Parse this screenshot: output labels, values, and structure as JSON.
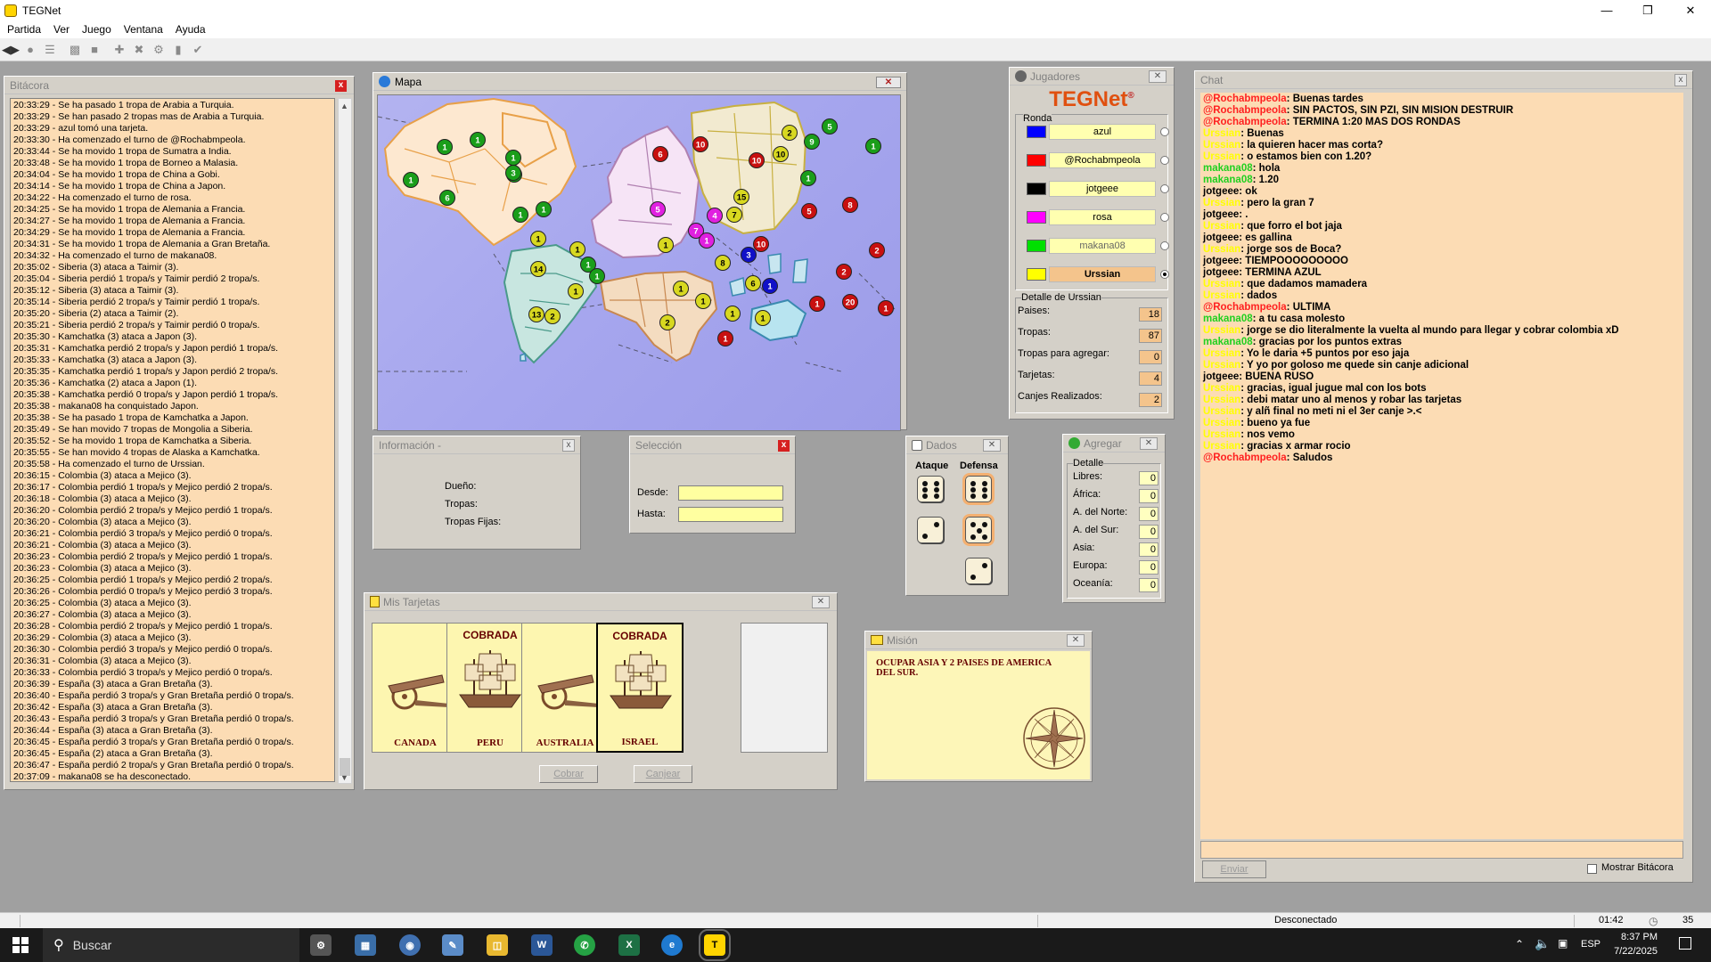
{
  "window": {
    "title": "TEGNet"
  },
  "menu": [
    "Partida",
    "Ver",
    "Juego",
    "Ventana",
    "Ayuda"
  ],
  "bitacora": {
    "title": "Bitácora",
    "lines": [
      "20:33:29 - Se ha pasado 1 tropa de Arabia a Turquia.",
      "20:33:29 - Se han pasado 2 tropas mas de Arabia a Turquia.",
      "20:33:29 - azul tomó una tarjeta.",
      "20:33:30 - Ha comenzado el turno de @Rochabmpeola.",
      "20:33:44 - Se ha movido 1 tropa de Sumatra a India.",
      "20:33:48 - Se ha movido 1 tropa de Borneo a Malasia.",
      "20:34:04 - Se ha movido 1 tropa de China a Gobi.",
      "20:34:14 - Se ha movido 1 tropa de China a Japon.",
      "20:34:22 - Ha comenzado el turno de rosa.",
      "20:34:25 - Se ha movido 1 tropa de Alemania a Francia.",
      "20:34:27 - Se ha movido 1 tropa de Alemania a Francia.",
      "20:34:29 - Se ha movido 1 tropa de Alemania a Francia.",
      "20:34:31 - Se ha movido 1 tropa de Alemania a Gran Bretaña.",
      "20:34:32 - Ha comenzado el turno de makana08.",
      "20:35:02 - Siberia (3) ataca a Taimir (3).",
      "20:35:04 - Siberia perdió 1 tropa/s y Taimir perdió 2 tropa/s.",
      "20:35:12 - Siberia (3) ataca a Taimir (3).",
      "20:35:14 - Siberia perdió 2 tropa/s y Taimir perdió 1 tropa/s.",
      "20:35:20 - Siberia (2) ataca a Taimir (2).",
      "20:35:21 - Siberia perdió 2 tropa/s y Taimir perdió 0 tropa/s.",
      "20:35:30 - Kamchatka (3) ataca a Japon (3).",
      "20:35:31 - Kamchatka perdió 2 tropa/s y Japon perdió 1 tropa/s.",
      "20:35:33 - Kamchatka (3) ataca a Japon (3).",
      "20:35:35 - Kamchatka perdió 1 tropa/s y Japon perdió 2 tropa/s.",
      "20:35:36 - Kamchatka (2) ataca a Japon (1).",
      "20:35:38 - Kamchatka perdió 0 tropa/s y Japon perdió 1 tropa/s.",
      "20:35:38 - makana08 ha conquistado Japon.",
      "20:35:38 - Se ha pasado 1 tropa de Kamchatka a Japon.",
      "20:35:49 - Se han movido 7 tropas de Mongolia a Siberia.",
      "20:35:52 - Se ha movido 1 tropa de Kamchatka a Siberia.",
      "20:35:55 - Se han movido 4 tropas de Alaska a Kamchatka.",
      "20:35:58 - Ha comenzado el turno de Urssian.",
      "20:36:15 - Colombia (3) ataca a Mejico (3).",
      "20:36:17 - Colombia perdió 1 tropa/s y Mejico perdió 2 tropa/s.",
      "20:36:18 - Colombia (3) ataca a Mejico (3).",
      "20:36:20 - Colombia perdió 2 tropa/s y Mejico perdió 1 tropa/s.",
      "20:36:20 - Colombia (3) ataca a Mejico (3).",
      "20:36:21 - Colombia perdió 3 tropa/s y Mejico perdió 0 tropa/s.",
      "20:36:21 - Colombia (3) ataca a Mejico (3).",
      "20:36:23 - Colombia perdió 2 tropa/s y Mejico perdió 1 tropa/s.",
      "20:36:23 - Colombia (3) ataca a Mejico (3).",
      "20:36:25 - Colombia perdió 1 tropa/s y Mejico perdió 2 tropa/s.",
      "20:36:26 - Colombia perdió 0 tropa/s y Mejico perdió 3 tropa/s.",
      "20:36:25 - Colombia (3) ataca a Mejico (3).",
      "20:36:27 - Colombia (3) ataca a Mejico (3).",
      "20:36:28 - Colombia perdió 2 tropa/s y Mejico perdió 1 tropa/s.",
      "20:36:29 - Colombia (3) ataca a Mejico (3).",
      "20:36:30 - Colombia perdió 3 tropa/s y Mejico perdió 0 tropa/s.",
      "20:36:31 - Colombia (3) ataca a Mejico (3).",
      "20:36:33 - Colombia perdió 3 tropa/s y Mejico perdió 0 tropa/s.",
      "20:36:39 - España (3) ataca a Gran Bretaña (3).",
      "20:36:40 - España perdió 3 tropa/s y Gran Bretaña perdió 0 tropa/s.",
      "20:36:42 - España (3) ataca a Gran Bretaña (3).",
      "20:36:43 - España perdió 3 tropa/s y Gran Bretaña perdió 0 tropa/s.",
      "20:36:44 - España (3) ataca a Gran Bretaña (3).",
      "20:36:45 - España perdió 3 tropa/s y Gran Bretaña perdió 0 tropa/s.",
      "20:36:45 - España (2) ataca a Gran Bretaña (3).",
      "20:36:47 - España perdió 2 tropa/s y Gran Bretaña perdió 0 tropa/s.",
      "20:37:09 - makana08 se ha desconectado."
    ]
  },
  "mapa": {
    "title": "Mapa",
    "markers": [
      {
        "n": "1",
        "c": "#1a9e1a"
      },
      {
        "n": "1",
        "c": "#1a9e1a"
      },
      {
        "n": "6",
        "c": "#1a9e1a"
      },
      {
        "n": "1",
        "c": "#1a9e1a"
      },
      {
        "n": "1",
        "c": "#1a9e1a"
      },
      {
        "n": "1",
        "c": "#1a9e1a"
      },
      {
        "n": "1",
        "c": "#1a9e1a"
      },
      {
        "n": "1",
        "c": "#1a9e1a"
      },
      {
        "n": "1",
        "c": "#1a9e1a"
      },
      {
        "n": "1",
        "c": "#1a9e1a"
      },
      {
        "n": "3",
        "c": "#1a9e1a"
      },
      {
        "n": "6",
        "c": "#c81010"
      },
      {
        "n": "10",
        "c": "#c81010"
      },
      {
        "n": "5",
        "c": "#e020e0"
      },
      {
        "n": "7",
        "c": "#e020e0"
      },
      {
        "n": "4",
        "c": "#e020e0"
      },
      {
        "n": "1",
        "c": "#e020e0"
      },
      {
        "n": "1",
        "c": "#d8d820"
      },
      {
        "n": "15",
        "c": "#d8d820"
      },
      {
        "n": "7",
        "c": "#d8d820"
      },
      {
        "n": "10",
        "c": "#c81010"
      },
      {
        "n": "3",
        "c": "#1010c8"
      },
      {
        "n": "6",
        "c": "#d8d820"
      },
      {
        "n": "1",
        "c": "#1010c8"
      },
      {
        "n": "10",
        "c": "#c81010"
      },
      {
        "n": "10",
        "c": "#d8d820"
      },
      {
        "n": "2",
        "c": "#d8d820"
      },
      {
        "n": "9",
        "c": "#1a9e1a"
      },
      {
        "n": "5",
        "c": "#1a9e1a"
      },
      {
        "n": "1",
        "c": "#1a9e1a"
      },
      {
        "n": "1",
        "c": "#1a9e1a"
      },
      {
        "n": "5",
        "c": "#c81010"
      },
      {
        "n": "8",
        "c": "#c81010"
      },
      {
        "n": "2",
        "c": "#c81010"
      },
      {
        "n": "2",
        "c": "#c81010"
      },
      {
        "n": "1",
        "c": "#d8d820"
      },
      {
        "n": "14",
        "c": "#d8d820"
      },
      {
        "n": "1",
        "c": "#d8d820"
      },
      {
        "n": "1",
        "c": "#d8d820"
      },
      {
        "n": "13",
        "c": "#d8d820"
      },
      {
        "n": "2",
        "c": "#d8d820"
      },
      {
        "n": "2",
        "c": "#d8d820"
      },
      {
        "n": "8",
        "c": "#d8d820"
      },
      {
        "n": "1",
        "c": "#d8d820"
      },
      {
        "n": "1",
        "c": "#d8d820"
      },
      {
        "n": "1",
        "c": "#d8d820"
      },
      {
        "n": "1",
        "c": "#d8d820"
      },
      {
        "n": "1",
        "c": "#c81010"
      },
      {
        "n": "1",
        "c": "#c81010"
      },
      {
        "n": "1",
        "c": "#c81010"
      },
      {
        "n": "20",
        "c": "#c81010"
      }
    ]
  },
  "informacion": {
    "title": "Información -",
    "labels": [
      "Dueño:",
      "Tropas:",
      "Tropas Fijas:"
    ]
  },
  "seleccion": {
    "title": "Selección",
    "desde": "Desde:",
    "hasta": "Hasta:"
  },
  "jugadores": {
    "title": "Jugadores",
    "logo": "TEGNet",
    "logo_reg": "®",
    "ronda_label": "Ronda",
    "players": [
      {
        "name": "azul",
        "color": "#0000ff"
      },
      {
        "name": "@Rochabmpeola",
        "color": "#ff0000"
      },
      {
        "name": "jotgeee",
        "color": "#000000"
      },
      {
        "name": "rosa",
        "color": "#ff00ff"
      },
      {
        "name": "makana08",
        "color": "#00e000"
      },
      {
        "name": "Urssian",
        "color": "#ffff00"
      }
    ],
    "detalle_title": "Detalle de Urssian",
    "detalle": [
      {
        "label": "Paises:",
        "value": "18"
      },
      {
        "label": "Tropas:",
        "value": "87"
      },
      {
        "label": "Tropas para agregar:",
        "value": "0"
      },
      {
        "label": "Tarjetas:",
        "value": "4"
      },
      {
        "label": "Canjes Realizados:",
        "value": "2"
      }
    ]
  },
  "dados": {
    "title": "Dados",
    "ataque": "Ataque",
    "defensa": "Defensa"
  },
  "agregar": {
    "title": "Agregar",
    "detalle": "Detalle",
    "rows": [
      {
        "label": "Libres:",
        "value": "0"
      },
      {
        "label": "África:",
        "value": "0"
      },
      {
        "label": "A. del Norte:",
        "value": "0"
      },
      {
        "label": "A. del Sur:",
        "value": "0"
      },
      {
        "label": "Asia:",
        "value": "0"
      },
      {
        "label": "Europa:",
        "value": "0"
      },
      {
        "label": "Oceanía:",
        "value": "0"
      }
    ]
  },
  "tarjetas": {
    "title": "Mis Tarjetas",
    "cards": [
      {
        "top": "",
        "name": "CANADA"
      },
      {
        "top": "COBRADA",
        "name": "PERU"
      },
      {
        "top": "",
        "name": "AUSTRALIA"
      },
      {
        "top": "COBRADA",
        "name": "ISRAEL"
      }
    ],
    "cobrar": "Cobrar",
    "canjear": "Canjear"
  },
  "mision": {
    "title": "Misión",
    "text": "OCUPAR ASIA Y 2 PAISES DE AMERICA DEL SUR."
  },
  "chat": {
    "title": "Chat",
    "enviar": "Enviar",
    "mostrar": "Mostrar Bitácora",
    "messages": [
      {
        "u": "@Rochabmpeola",
        "c": "#ff2020",
        "t": "Buenas tardes"
      },
      {
        "u": "@Rochabmpeola",
        "c": "#ff2020",
        "t": "SIN PACTOS, SIN PZI, SIN MISION DESTRUIR"
      },
      {
        "u": "@Rochabmpeola",
        "c": "#ff2020",
        "t": "TERMINA 1:20 MAS DOS RONDAS"
      },
      {
        "u": "Urssian",
        "c": "#ffff00",
        "t": "Buenas"
      },
      {
        "u": "Urssian",
        "c": "#ffff00",
        "t": "la quieren hacer mas corta?"
      },
      {
        "u": "Urssian",
        "c": "#ffff00",
        "t": "o estamos bien con 1.20?"
      },
      {
        "u": "makana08",
        "c": "#20d020",
        "t": "hola"
      },
      {
        "u": "makana08",
        "c": "#20d020",
        "t": "1.20"
      },
      {
        "u": "jotgeee",
        "c": "#000000",
        "t": "ok"
      },
      {
        "u": "Urssian",
        "c": "#ffff00",
        "t": "pero la gran 7"
      },
      {
        "u": "jotgeee",
        "c": "#000000",
        "t": "."
      },
      {
        "u": "Urssian",
        "c": "#ffff00",
        "t": "que forro el bot jaja"
      },
      {
        "u": "jotgeee",
        "c": "#000000",
        "t": "es gallina"
      },
      {
        "u": "Urssian",
        "c": "#ffff00",
        "t": "jorge sos de Boca?"
      },
      {
        "u": "jotgeee",
        "c": "#000000",
        "t": "TIEMPOOOOOOOOO"
      },
      {
        "u": "jotgeee",
        "c": "#000000",
        "t": "TERMINA AZUL"
      },
      {
        "u": "Urssian",
        "c": "#ffff00",
        "t": "que dadamos mamadera"
      },
      {
        "u": "Urssian",
        "c": "#ffff00",
        "t": "dados"
      },
      {
        "u": "@Rochabmpeola",
        "c": "#ff2020",
        "t": "ULTIMA"
      },
      {
        "u": "makana08",
        "c": "#20d020",
        "t": "a tu casa molesto"
      },
      {
        "u": "Urssian",
        "c": "#ffff00",
        "t": "jorge se dio literalmente la vuelta al mundo para llegar y cobrar colombia xD"
      },
      {
        "u": "makana08",
        "c": "#20d020",
        "t": "gracias por los puntos extras"
      },
      {
        "u": "Urssian",
        "c": "#ffff00",
        "t": "Yo le daria +5 puntos por eso jaja"
      },
      {
        "u": "Urssian",
        "c": "#ffff00",
        "t": "Y yo por goloso me quede sin canje adicional"
      },
      {
        "u": "jotgeee",
        "c": "#000000",
        "t": "BUENA RUSO"
      },
      {
        "u": "Urssian",
        "c": "#ffff00",
        "t": "gracias, igual jugue mal con los bots"
      },
      {
        "u": "Urssian",
        "c": "#ffff00",
        "t": "debi matar uno al menos y robar las tarjetas"
      },
      {
        "u": "Urssian",
        "c": "#ffff00",
        "t": "y alñ final no meti ni el 3er canje >.<"
      },
      {
        "u": "Urssian",
        "c": "#ffff00",
        "t": "bueno ya fue"
      },
      {
        "u": "Urssian",
        "c": "#ffff00",
        "t": "nos vemo"
      },
      {
        "u": "Urssian",
        "c": "#ffff00",
        "t": "gracias x armar rocio"
      },
      {
        "u": "@Rochabmpeola",
        "c": "#ff2020",
        "t": "Saludos"
      }
    ]
  },
  "status": {
    "text": "Desconectado",
    "time": "01:42",
    "count": "35"
  },
  "taskbar": {
    "search": "Buscar",
    "lang": "ESP",
    "time": "8:37 PM",
    "date": "7/22/2025"
  }
}
